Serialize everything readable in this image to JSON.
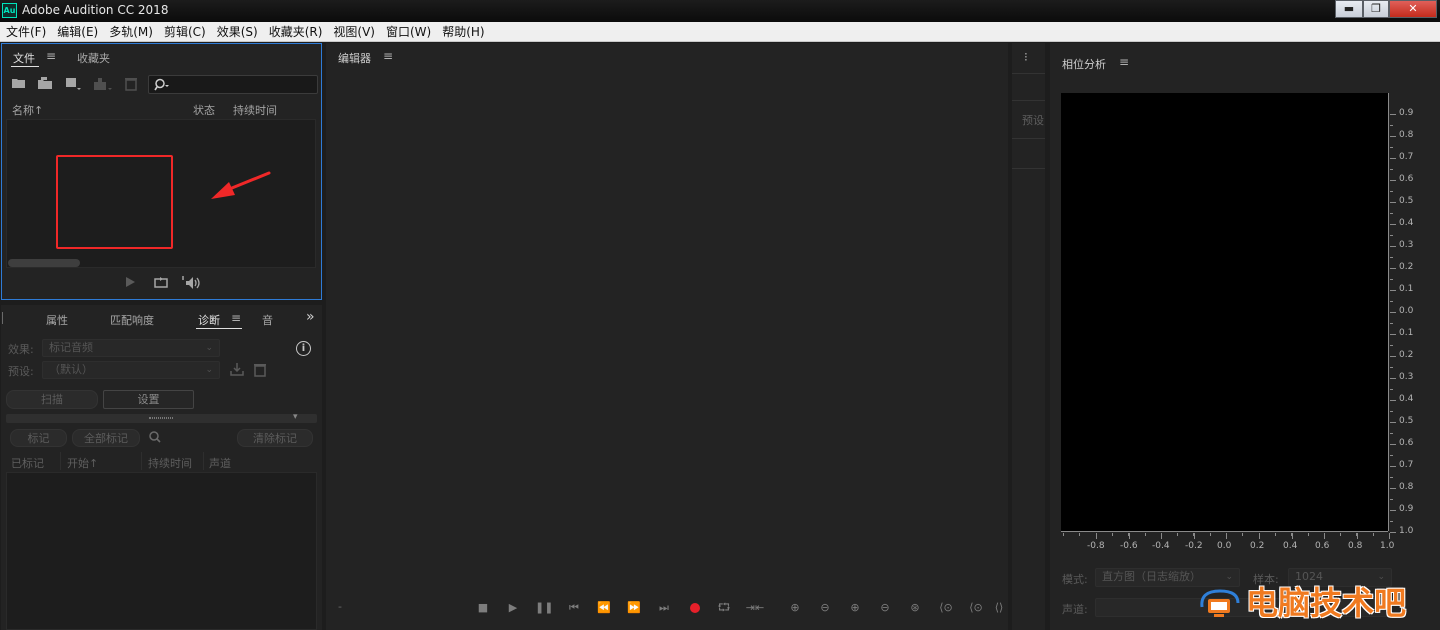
{
  "window": {
    "title": "Adobe Audition CC 2018",
    "app_icon": "Au"
  },
  "menu": [
    "文件(F)",
    "编辑(E)",
    "多轨(M)",
    "剪辑(C)",
    "效果(S)",
    "收藏夹(R)",
    "视图(V)",
    "窗口(W)",
    "帮助(H)"
  ],
  "files_panel": {
    "tabs": [
      "文件",
      "收藏夹"
    ],
    "search_placeholder": "",
    "columns": [
      "名称",
      "状态",
      "持续时间"
    ],
    "sort_indicator": "↑"
  },
  "diag_panel": {
    "tabs": [
      "属性",
      "匹配响度",
      "诊断",
      "音"
    ],
    "effect_label": "效果:",
    "effect_value": "标记音频",
    "preset_label": "预设:",
    "preset_value": "（默认）",
    "scan_label": "扫描",
    "settings_label": "设置",
    "mark_label": "标记",
    "mark_all_label": "全部标记",
    "clear_marks_label": "清除标记",
    "columns": [
      "已标记",
      "开始",
      "持续时间",
      "声道"
    ]
  },
  "editor": {
    "title": "编辑器",
    "time_dash": "-"
  },
  "strip": {
    "label": "预设"
  },
  "phase_panel": {
    "title": "相位分析",
    "y_labels": [
      "0.9",
      "0.8",
      "0.7",
      "0.6",
      "0.5",
      "0.4",
      "0.3",
      "0.2",
      "0.1",
      "0.0",
      "0.1",
      "0.2",
      "0.3",
      "0.4",
      "0.5",
      "0.6",
      "0.7",
      "0.8",
      "0.9",
      "1.0"
    ],
    "x_labels": [
      "-0.8",
      "-0.6",
      "-0.4",
      "-0.2",
      "0.0",
      "0.2",
      "0.4",
      "0.6",
      "0.8",
      "1.0"
    ],
    "mode_label": "模式:",
    "mode_value": "直方图（日志缩放）",
    "sample_label": "样本:",
    "sample_value": "1024",
    "channel_label": "声道:"
  },
  "watermark": {
    "text": "电脑技术吧"
  },
  "colors": {
    "accent_blue": "#2e7bd6",
    "annotation_red": "#f02828",
    "record_red": "#e6202a",
    "watermark_orange": "#f07a20"
  }
}
